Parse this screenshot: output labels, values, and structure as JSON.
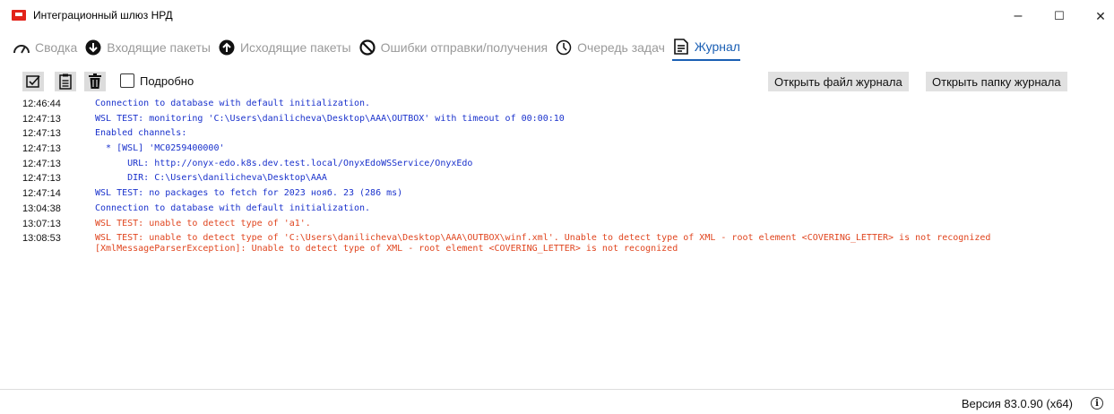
{
  "window": {
    "title": "Интеграционный шлюз НРД",
    "minimize_glyph": "–",
    "maximize_glyph": "☐",
    "close_glyph": "✕"
  },
  "tabs": [
    {
      "label": "Сводка",
      "icon": "gauge-icon"
    },
    {
      "label": "Входящие пакеты",
      "icon": "arrow-down-circle-icon"
    },
    {
      "label": "Исходящие пакеты",
      "icon": "arrow-up-circle-icon"
    },
    {
      "label": "Ошибки отправки/получения",
      "icon": "prohibited-icon"
    },
    {
      "label": "Очередь задач",
      "icon": "clock-icon"
    },
    {
      "label": "Журнал",
      "icon": "document-icon",
      "active": true
    }
  ],
  "toolbar": {
    "verbose_label": "Подробно",
    "open_log_file": "Открыть файл журнала",
    "open_log_folder": "Открыть папку журнала"
  },
  "log": [
    {
      "time": "12:46:44",
      "text": "Connection to database with default initialization.",
      "color": "#1a32cc"
    },
    {
      "time": "12:47:13",
      "text": "WSL TEST: monitoring 'C:\\Users\\danilicheva\\Desktop\\AAA\\OUTBOX' with timeout of 00:00:10",
      "color": "#1a32cc"
    },
    {
      "time": "12:47:13",
      "text": "Enabled channels:",
      "color": "#1a32cc"
    },
    {
      "time": "12:47:13",
      "text": "  * [WSL] 'MC0259400000'",
      "color": "#1a32cc"
    },
    {
      "time": "12:47:13",
      "text": "      URL: http://onyx-edo.k8s.dev.test.local/OnyxEdoWSService/OnyxEdo",
      "color": "#1a32cc"
    },
    {
      "time": "12:47:13",
      "text": "      DIR: C:\\Users\\danilicheva\\Desktop\\AAA",
      "color": "#1a32cc"
    },
    {
      "time": "12:47:14",
      "text": "WSL TEST: no packages to fetch for 2023 нояб. 23 (286 ms)",
      "color": "#1a32cc"
    },
    {
      "time": "13:04:38",
      "text": "Connection to database with default initialization.",
      "color": "#1a32cc"
    },
    {
      "time": "13:07:13",
      "text": "WSL TEST: unable to detect type of 'a1'.",
      "color": "#e0451f"
    },
    {
      "time": "13:08:53",
      "text": "WSL TEST: unable to detect type of 'C:\\Users\\danilicheva\\Desktop\\AAA\\OUTBOX\\winf.xml'. Unable to detect type of XML - root element <COVERING_LETTER> is not recognized",
      "color": "#e0451f"
    },
    {
      "time": "",
      "text": "[XmlMessageParserException]: Unable to detect type of XML - root element <COVERING_LETTER> is not recognized",
      "color": "#e0451f"
    }
  ],
  "status": {
    "version": "Версия 83.0.90 (x64)",
    "info_glyph": "i"
  },
  "colors": {
    "brand_red": "#e2231a",
    "active_tab": "#1a5fb4",
    "log_info": "#1a32cc",
    "log_error": "#e0451f"
  }
}
